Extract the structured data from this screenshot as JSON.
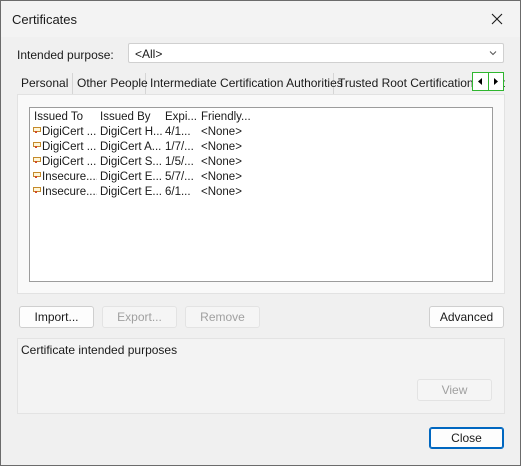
{
  "window": {
    "title": "Certificates",
    "close_icon": "close-icon"
  },
  "purpose": {
    "label": "Intended purpose:",
    "selected": "<All>"
  },
  "tabs": [
    {
      "label": "Personal"
    },
    {
      "label": "Other People"
    },
    {
      "label": "Intermediate Certification Authorities"
    },
    {
      "label": "Trusted Root Certification Authorities"
    }
  ],
  "tab_scroll": {
    "left_icon": "arrow-left-icon",
    "right_icon": "arrow-right-icon"
  },
  "list": {
    "columns": [
      "Issued To",
      "Issued By",
      "Expi...",
      "Friendly..."
    ],
    "rows": [
      [
        "DigiCert ...",
        "DigiCert H...",
        "4/1...",
        "<None>"
      ],
      [
        "DigiCert ...",
        "DigiCert A...",
        "1/7/...",
        "<None>"
      ],
      [
        "DigiCert ...",
        "DigiCert S...",
        "1/5/...",
        "<None>"
      ],
      [
        "Insecure....",
        "DigiCert E...",
        "5/7/...",
        "<None>"
      ],
      [
        "Insecure....",
        "DigiCert E...",
        "6/1...",
        "<None>"
      ]
    ],
    "row_icon": "certificate-icon"
  },
  "buttons": {
    "import": "Import...",
    "export": "Export...",
    "remove": "Remove",
    "advanced": "Advanced",
    "view": "View",
    "close": "Close"
  },
  "purposes_group": {
    "label": "Certificate intended purposes"
  },
  "colors": {
    "accent": "#0067c0",
    "focus_green": "#2fb62f",
    "dialog_bg": "#f0f0f0"
  }
}
